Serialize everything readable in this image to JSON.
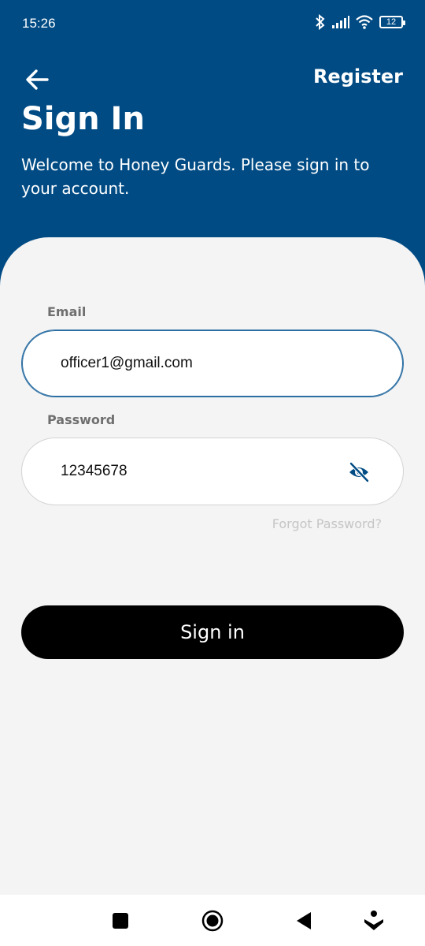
{
  "status_bar": {
    "time": "15:26",
    "battery": "12"
  },
  "header": {
    "register_label": "Register",
    "title": "Sign In",
    "subtitle": "Welcome to Honey Guards. Please sign in to your account."
  },
  "form": {
    "email_label": "Email",
    "email_value": "officer1@gmail.com",
    "password_label": "Password",
    "password_value": "12345678",
    "forgot_label": "Forgot Password?",
    "signin_label": "Sign in"
  },
  "colors": {
    "primary": "#004b84",
    "button": "#000000",
    "background": "#f4f4f4"
  },
  "icons": [
    "back-arrow-icon",
    "bluetooth-icon",
    "signal-icon",
    "wifi-icon",
    "battery-icon",
    "eye-off-icon",
    "recent-apps-icon",
    "home-icon",
    "back-icon",
    "assistant-icon"
  ]
}
